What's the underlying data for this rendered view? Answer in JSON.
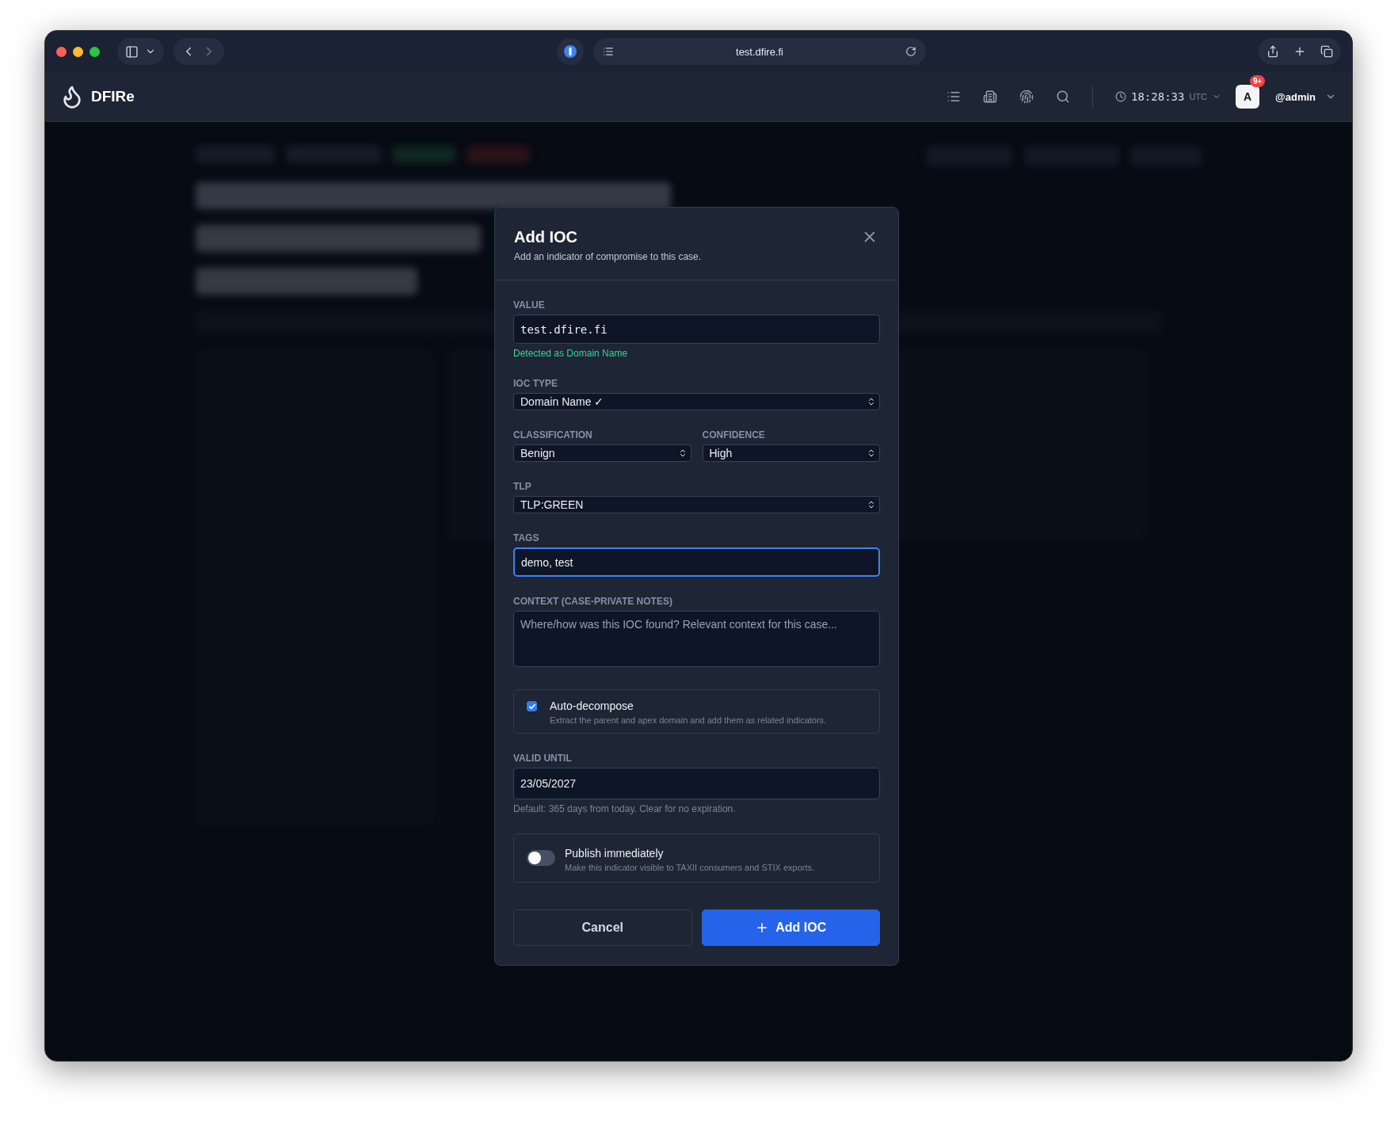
{
  "browser": {
    "url": "test.dfire.fi"
  },
  "app": {
    "brand": "DFIRe",
    "clock": {
      "time": "18:28:33",
      "zone": "UTC"
    },
    "notifications": "9+",
    "avatar": "A",
    "user": "@admin"
  },
  "dialog": {
    "title": "Add IOC",
    "subtitle": "Add an indicator of compromise to this case.",
    "value": {
      "label": "VALUE",
      "value": "test.dfire.fi",
      "detection": "Detected as Domain Name"
    },
    "ioc_type": {
      "label": "IOC TYPE",
      "value": "Domain Name ✓"
    },
    "classification": {
      "label": "CLASSIFICATION",
      "value": "Benign"
    },
    "confidence": {
      "label": "CONFIDENCE",
      "value": "High"
    },
    "tlp": {
      "label": "TLP",
      "value": "TLP:GREEN"
    },
    "tags": {
      "label": "TAGS",
      "value": "demo, test",
      "focused": true
    },
    "context": {
      "label": "CONTEXT (CASE-PRIVATE NOTES)",
      "placeholder": "Where/how was this IOC found? Relevant context for this case..."
    },
    "auto_decompose": {
      "label": "Auto-decompose",
      "description": "Extract the parent and apex domain and add them as related indicators.",
      "checked": true
    },
    "valid_until": {
      "label": "VALID UNTIL",
      "value": "23/05/2027",
      "hint": "Default: 365 days from today. Clear for no expiration."
    },
    "publish": {
      "label": "Publish immediately",
      "description": "Make this indicator visible to TAXII consumers and STIX exports.",
      "on": false
    },
    "cancel": "Cancel",
    "submit": "Add IOC"
  }
}
